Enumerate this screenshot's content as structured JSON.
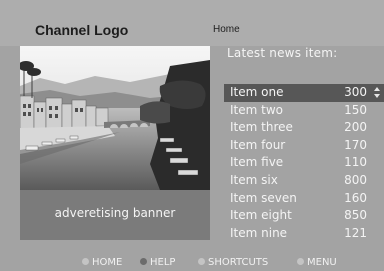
{
  "header": {
    "logo_text": "Channel Logo",
    "breadcrumb": "Home"
  },
  "banner": {
    "text": "adveretising banner"
  },
  "news": {
    "heading": "Latest news item:",
    "items": [
      {
        "label": "Item one",
        "value": "300",
        "selected": true
      },
      {
        "label": "Item two",
        "value": "150"
      },
      {
        "label": "Item three",
        "value": "200"
      },
      {
        "label": "Item four",
        "value": "170"
      },
      {
        "label": "Item five",
        "value": "110"
      },
      {
        "label": "Item six",
        "value": "800"
      },
      {
        "label": "Item seven",
        "value": "160"
      },
      {
        "label": "Item eight",
        "value": "850"
      },
      {
        "label": "Item nine",
        "value": "121"
      }
    ]
  },
  "footer": {
    "items": [
      {
        "label": "HOME",
        "icon": "dot-icon"
      },
      {
        "label": "HELP",
        "icon": "dot-icon"
      },
      {
        "label": "SHORTCUTS",
        "icon": "dot-icon"
      },
      {
        "label": "MENU",
        "icon": "dot-icon"
      }
    ]
  },
  "colors": {
    "background": "#a3a3a3",
    "panel": "#7b7b7b",
    "selection": "#575757",
    "text_light": "#f4f4f4"
  }
}
